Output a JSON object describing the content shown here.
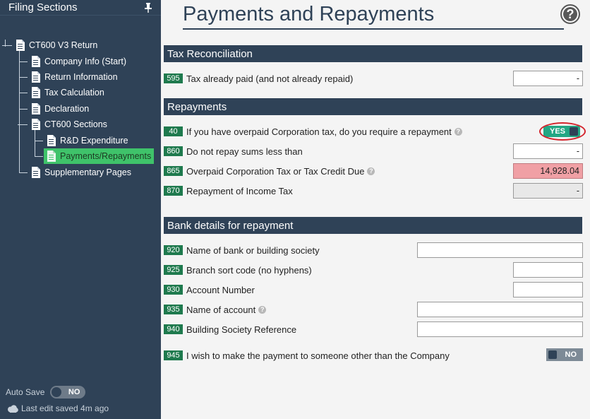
{
  "sidebar": {
    "title": "Filing Sections",
    "collapse_glyph": "»",
    "tree": [
      {
        "label": "CT600 V3 Return"
      },
      {
        "label": "Company Info (Start)"
      },
      {
        "label": "Return Information"
      },
      {
        "label": "Tax Calculation"
      },
      {
        "label": "Declaration"
      },
      {
        "label": "CT600 Sections"
      },
      {
        "label": "R&D Expenditure"
      },
      {
        "label": "Payments/Repayments",
        "active": true
      },
      {
        "label": "Supplementary Pages"
      }
    ],
    "autosave_label": "Auto Save",
    "autosave_value": "NO",
    "last_saved": "Last edit saved 4m ago"
  },
  "main": {
    "title": "Payments and Repayments",
    "help_glyph": "?",
    "sections": {
      "tax_reconciliation": "Tax Reconciliation",
      "repayments": "Repayments",
      "bank_details": "Bank details for repayment"
    },
    "rows": {
      "r595": {
        "code": "595",
        "label": "Tax already paid (and not already repaid)",
        "value": "-"
      },
      "r40": {
        "code": "40",
        "label": "If you have overpaid Corporation tax, do you require a repayment",
        "toggle": "YES"
      },
      "r860": {
        "code": "860",
        "label": "Do not repay sums less than",
        "value": "-"
      },
      "r865": {
        "code": "865",
        "label": "Overpaid Corporation Tax or Tax Credit Due",
        "value": "14,928.04"
      },
      "r870": {
        "code": "870",
        "label": "Repayment of Income Tax",
        "value": "-"
      },
      "r920": {
        "code": "920",
        "label": "Name of bank or building society",
        "value": ""
      },
      "r925": {
        "code": "925",
        "label": "Branch sort code (no hyphens)",
        "value": ""
      },
      "r930": {
        "code": "930",
        "label": "Account Number",
        "value": ""
      },
      "r935": {
        "code": "935",
        "label": "Name of account",
        "value": ""
      },
      "r940": {
        "code": "940",
        "label": "Building Society Reference",
        "value": ""
      },
      "r945": {
        "code": "945",
        "label": "I wish to make the payment to someone other than the Company",
        "toggle": "NO"
      }
    }
  },
  "colors": {
    "sidebar_bg": "#2f4257",
    "active_item": "#3fc36a",
    "code_badge": "#1f7a4e",
    "toggle_yes": "#23a784",
    "overpaid_field": "#f0a0a5",
    "highlight_ring": "#d3262e"
  }
}
